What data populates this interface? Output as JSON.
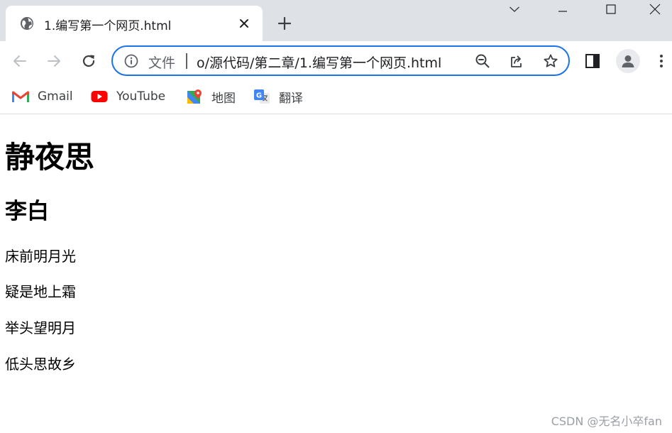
{
  "browser": {
    "tab": {
      "title": "1.编写第一个网页.html"
    },
    "omnibox": {
      "security_chip": "文件",
      "url": "/源代码/第二章/1.编写第一个网页.html",
      "url_visible_prefix": "o"
    },
    "bookmarks": [
      {
        "label": "Gmail",
        "icon": "gmail-icon"
      },
      {
        "label": "YouTube",
        "icon": "youtube-icon"
      },
      {
        "label": "地图",
        "icon": "maps-icon"
      },
      {
        "label": "翻译",
        "icon": "translate-icon"
      }
    ],
    "accent_color": "#1a73e8"
  },
  "page": {
    "title": "静夜思",
    "author": "李白",
    "lines": [
      "床前明月光",
      "疑是地上霜",
      "举头望明月",
      "低头思故乡"
    ]
  },
  "watermark": "CSDN @无名小卒fan"
}
